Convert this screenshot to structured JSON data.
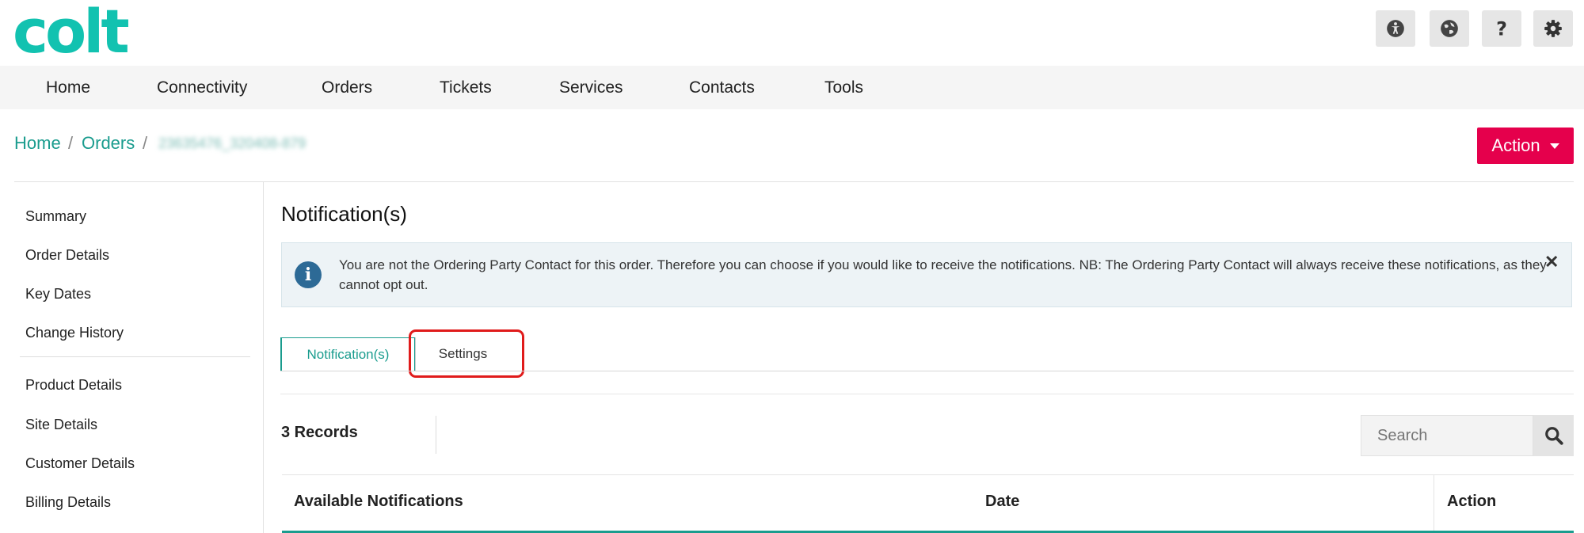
{
  "brand": {
    "logo_text": "colt",
    "accent_color": "#12c2b0",
    "action_color": "#e5004c"
  },
  "header_icons": [
    {
      "name": "accessibility-icon"
    },
    {
      "name": "globe-icon"
    },
    {
      "name": "help-icon"
    },
    {
      "name": "gear-icon"
    }
  ],
  "nav": {
    "items": [
      "Home",
      "Connectivity",
      "Orders",
      "Tickets",
      "Services",
      "Contacts",
      "Tools"
    ]
  },
  "breadcrumb": {
    "home": "Home",
    "orders": "Orders",
    "separator": "/",
    "current": "23635476_320408-879"
  },
  "action_button": {
    "label": "Action"
  },
  "sidebar": {
    "items": [
      "Summary",
      "Order Details",
      "Key Dates",
      "Change History",
      "Product Details",
      "Site Details",
      "Customer Details",
      "Billing Details"
    ]
  },
  "main": {
    "title": "Notification(s)",
    "alert": {
      "text": "You are not the Ordering Party Contact for this order. Therefore you can choose if you would like to receive the notifications. NB: The Ordering Party Contact will always receive these notifications, as they cannot opt out.",
      "close": "✕"
    },
    "tabs": [
      "Notification(s)",
      "Settings"
    ],
    "records": "3 Records",
    "search": {
      "placeholder": "Search"
    },
    "table": {
      "headers": [
        "Available Notifications",
        "Date",
        "Action"
      ]
    }
  }
}
